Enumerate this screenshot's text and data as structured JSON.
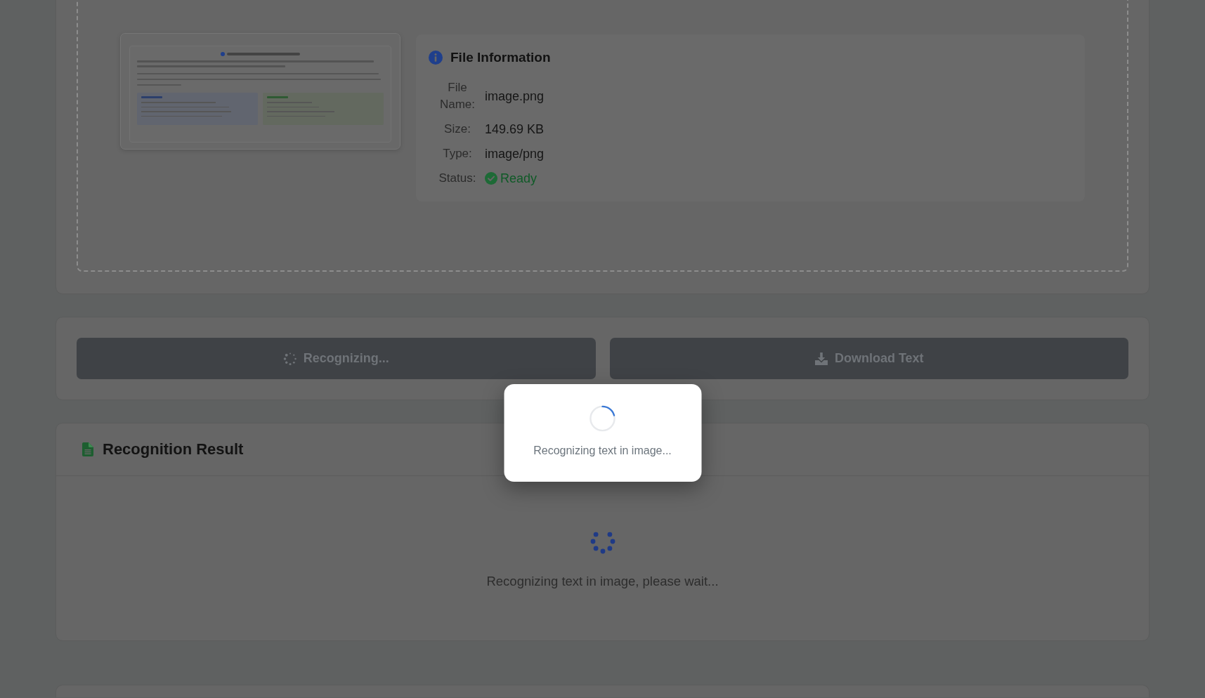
{
  "file_info": {
    "title": "File Information",
    "rows": [
      {
        "kind": "text",
        "label": "File Name:",
        "value": "image.png"
      },
      {
        "kind": "text",
        "label": "Size:",
        "value": "149.69 KB"
      },
      {
        "kind": "text",
        "label": "Type:",
        "value": "image/png"
      },
      {
        "kind": "status",
        "label": "Status:",
        "value": "Ready"
      }
    ]
  },
  "actions": [
    {
      "kind": "recognize",
      "label": "Recognizing...",
      "disabled": true
    },
    {
      "kind": "download",
      "label": "Download Text",
      "disabled": true
    }
  ],
  "result": {
    "title": "Recognition Result",
    "loading_text": "Recognizing text in image, please wait..."
  },
  "dialog": {
    "text": "Recognizing text in image..."
  }
}
